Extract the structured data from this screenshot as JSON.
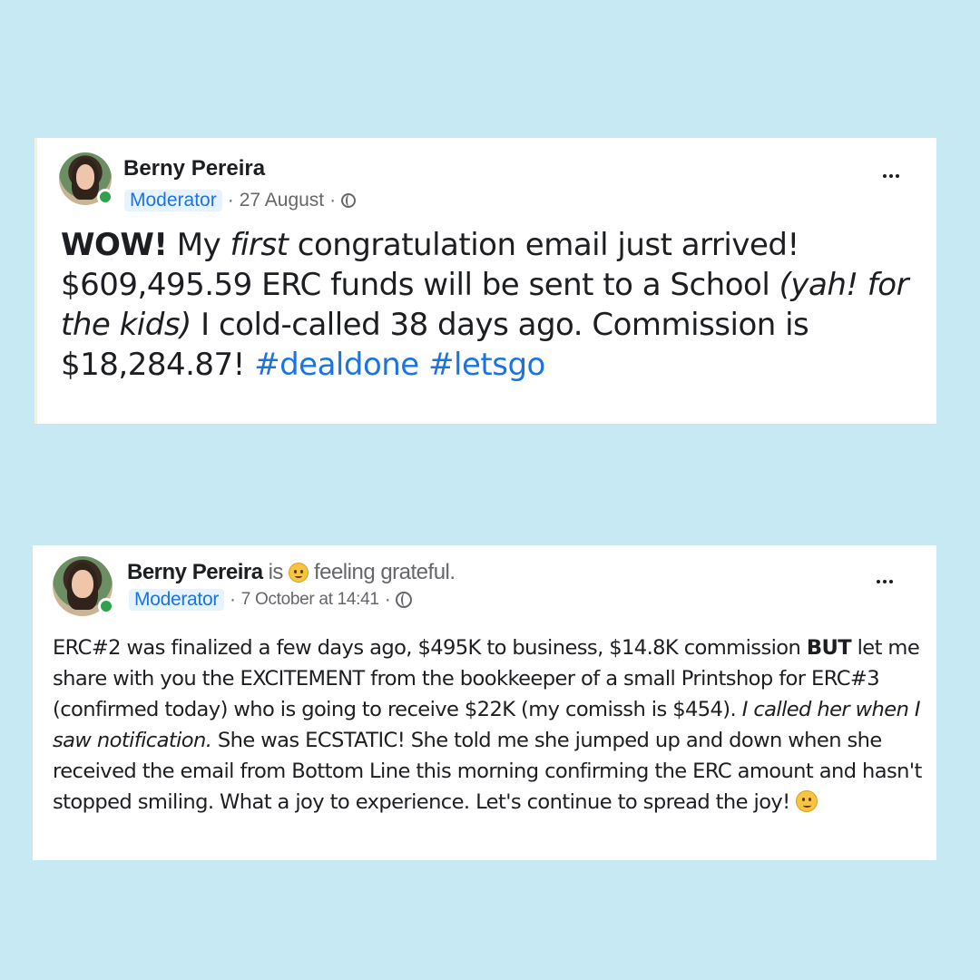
{
  "posts": [
    {
      "author": "Berny Pereira",
      "badge": "Moderator",
      "date": "27 August",
      "sep": "·",
      "body": {
        "bold": "WOW!",
        "t1": " My ",
        "italic1": "first",
        "t2": " congratulation email just arrived! $609,495.59 ERC funds will be sent to a School ",
        "italic2": "(yah! for the kids)",
        "t3": " I cold-called 38 days ago. Commission is $18,284.87! ",
        "tag1": "#dealdone",
        "tag2": "#letsgo"
      }
    },
    {
      "author": "Berny Pereira",
      "feeling_is": "is",
      "feeling": "feeling grateful.",
      "badge": "Moderator",
      "date": "7 October at 14:41",
      "sep": "·",
      "body": {
        "t1": "ERC#2 was finalized a few days ago, $495K to business, $14.8K commission ",
        "bold": "BUT",
        "t2": " let me share with you the EXCITEMENT from the bookkeeper of a small Printshop for ERC#3 (confirmed today) who is going to receive $22K (my comissh is $454). ",
        "italic": "I called her when I saw notification.",
        "t3": " She was ECSTATIC! She told me she jumped up and down when she received the email from Bottom Line this morning confirming the ERC amount and hasn't stopped smiling. What a joy to experience. Let's continue to spread the joy! "
      }
    }
  ],
  "icons": {
    "more": "more-options-icon",
    "globe": "globe-icon",
    "feeling": "grateful-emoji-icon",
    "smile": "smile-emoji-icon",
    "online": "online-status-icon"
  },
  "colors": {
    "background": "#c7e9f3",
    "link": "#1b74e4",
    "badge_bg": "#e7f3ff",
    "online": "#31a24c"
  }
}
